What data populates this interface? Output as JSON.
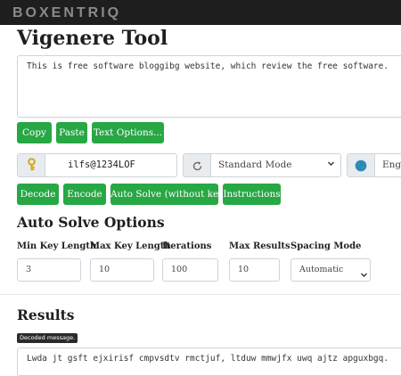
{
  "brand": {
    "logo_text": "BOXENTRIQ"
  },
  "page": {
    "title": "Vigenere Tool"
  },
  "input": {
    "text": "This is free software bloggibg website, which review the free software."
  },
  "text_buttons": {
    "copy": "Copy",
    "paste": "Paste",
    "text_options": "Text Options..."
  },
  "key": {
    "value": "ilfs@1234LOF",
    "icon": "key-icon"
  },
  "mode": {
    "icon": "refresh-icon",
    "selected": "Standard Mode"
  },
  "language": {
    "icon": "globe-icon",
    "selected": "English"
  },
  "action_buttons": {
    "decode": "Decode",
    "encode": "Encode",
    "auto_solve": "Auto Solve (without key)",
    "instructions": "Instructions"
  },
  "auto_solve": {
    "heading": "Auto Solve Options",
    "fields": [
      {
        "label": "Min Key Length",
        "value": "3"
      },
      {
        "label": "Max Key Length",
        "value": "10"
      },
      {
        "label": "Iterations",
        "value": "100"
      },
      {
        "label": "Max Results",
        "value": "10"
      },
      {
        "label": "Spacing Mode",
        "value": "Automatic"
      }
    ]
  },
  "results": {
    "heading": "Results",
    "badge": "Decoded message.",
    "text": "Lwda jt gsft ejxirisf cmpvsdtv rmctjuf, ltduw mmwjfx uwq ajtz apguxbgq."
  },
  "colors": {
    "accent_green": "#28a745",
    "topbar": "#1e1e1e"
  }
}
